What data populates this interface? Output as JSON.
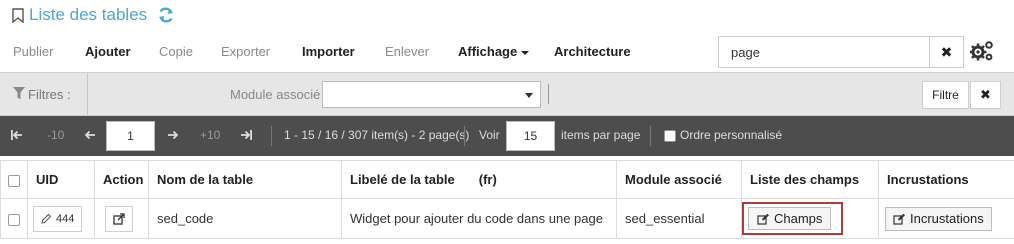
{
  "header": {
    "title": "Liste des tables",
    "bookmark_icon": "bookmark-icon",
    "refresh_icon": "refresh-icon",
    "accent_color": "#4aa7d6"
  },
  "toolbar": {
    "publier": "Publier",
    "ajouter": "Ajouter",
    "copie": "Copie",
    "exporter": "Exporter",
    "importer": "Importer",
    "enlever": "Enlever",
    "affichage": "Affichage",
    "architecture": "Architecture",
    "search_value": "page",
    "clear_symbol": "✖",
    "settings_icon": "cogs-icon"
  },
  "filters": {
    "label": "Filtres :",
    "module_label": "Module associé",
    "module_value": "",
    "filtre_button": "Filtre",
    "clear_symbol": "✖"
  },
  "pager": {
    "prev_step": "-10",
    "current_page": "1",
    "next_step": "+10",
    "summary": "1 - 15 / 16 / 307 item(s) - 2 page(s)",
    "voir_label": "Voir",
    "per_page": "15",
    "per_page_label": "items par page",
    "order_label": "Ordre personnalisé"
  },
  "table": {
    "columns": {
      "uid": "UID",
      "action": "Action",
      "name": "Nom de la table",
      "libelle": "Libelé de la table",
      "libelle_lang": "(fr)",
      "module": "Module associé",
      "champs": "Liste des champs",
      "incrustations": "Incrustations"
    },
    "rows": [
      {
        "uid": "444",
        "name": "sed_code",
        "libelle": "Widget pour ajouter du code dans une page",
        "module": "sed_essential",
        "champs_button": "Champs",
        "incrustations_button": "Incrustations"
      }
    ],
    "highlight_color": "#b03a3a"
  }
}
